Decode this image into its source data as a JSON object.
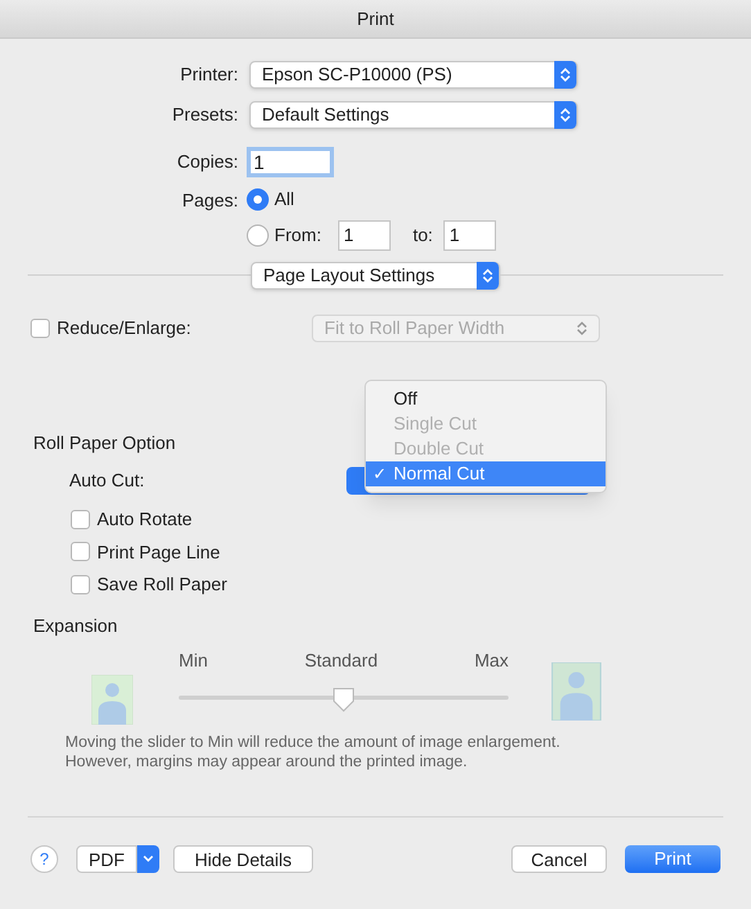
{
  "window": {
    "title": "Print"
  },
  "printer": {
    "label": "Printer:",
    "value": "Epson SC-P10000 (PS)"
  },
  "presets": {
    "label": "Presets:",
    "value": "Default Settings"
  },
  "copies": {
    "label": "Copies:",
    "value": "1"
  },
  "pages": {
    "label": "Pages:",
    "options": [
      {
        "label": "All",
        "selected": true
      },
      {
        "label": "From:",
        "selected": false,
        "from": "1",
        "to_label": "to:",
        "to": "1"
      }
    ]
  },
  "section_popup": {
    "value": "Page Layout Settings"
  },
  "reduce_enlarge": {
    "label": "Reduce/Enlarge:",
    "checked": false,
    "value": "Fit to Roll Paper Width",
    "disabled": true
  },
  "roll_paper": {
    "title": "Roll Paper Option",
    "auto_cut_label": "Auto Cut:",
    "menu": [
      {
        "label": "Off",
        "disabled": false,
        "selected": false
      },
      {
        "label": "Single Cut",
        "disabled": true,
        "selected": false
      },
      {
        "label": "Double Cut",
        "disabled": true,
        "selected": false
      },
      {
        "label": "Normal Cut",
        "disabled": false,
        "selected": true
      }
    ],
    "check_mark": "✓",
    "options": [
      {
        "label": "Auto Rotate",
        "checked": false
      },
      {
        "label": "Print Page Line",
        "checked": false
      },
      {
        "label": "Save Roll Paper",
        "checked": false
      }
    ]
  },
  "expansion": {
    "title": "Expansion",
    "labels": [
      "Min",
      "Standard",
      "Max"
    ],
    "level": 0.5,
    "description": [
      "Moving the slider to Min will reduce the amount of image enlargement.",
      "However, margins may appear around the printed image."
    ]
  },
  "footer": {
    "help": "?",
    "pdf": "PDF",
    "hide_details": "Hide Details",
    "cancel": "Cancel",
    "print": "Print"
  }
}
